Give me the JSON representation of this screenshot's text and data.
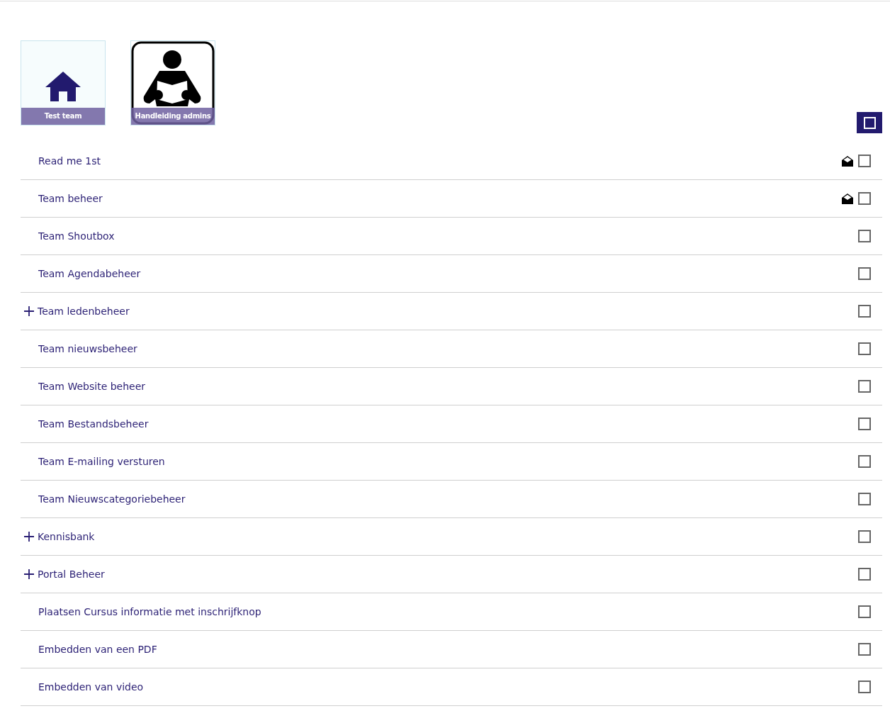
{
  "tiles": [
    {
      "kind": "home",
      "label": "Test team"
    },
    {
      "kind": "reader",
      "label": "Handleiding admins"
    }
  ],
  "items": [
    {
      "label": "Read me 1st",
      "expandable": false,
      "mail": true,
      "checked": false
    },
    {
      "label": "Team beheer",
      "expandable": false,
      "mail": true,
      "checked": false
    },
    {
      "label": "Team Shoutbox",
      "expandable": false,
      "mail": false,
      "checked": false
    },
    {
      "label": "Team Agendabeheer",
      "expandable": false,
      "mail": false,
      "checked": false
    },
    {
      "label": "Team ledenbeheer",
      "expandable": true,
      "mail": false,
      "checked": false
    },
    {
      "label": "Team nieuwsbeheer",
      "expandable": false,
      "mail": false,
      "checked": false
    },
    {
      "label": "Team Website beheer",
      "expandable": false,
      "mail": false,
      "checked": false
    },
    {
      "label": "Team Bestandsbeheer",
      "expandable": false,
      "mail": false,
      "checked": false
    },
    {
      "label": "Team E-mailing versturen",
      "expandable": false,
      "mail": false,
      "checked": false
    },
    {
      "label": "Team Nieuwscategoriebeheer",
      "expandable": false,
      "mail": false,
      "checked": false
    },
    {
      "label": "Kennisbank",
      "expandable": true,
      "mail": false,
      "checked": false
    },
    {
      "label": "Portal Beheer",
      "expandable": true,
      "mail": false,
      "checked": false
    },
    {
      "label": "Plaatsen Cursus informatie met inschrijfknop",
      "expandable": false,
      "mail": false,
      "checked": false
    },
    {
      "label": "Embedden van een PDF",
      "expandable": false,
      "mail": false,
      "checked": false
    },
    {
      "label": "Embedden van video",
      "expandable": false,
      "mail": false,
      "checked": false
    }
  ]
}
